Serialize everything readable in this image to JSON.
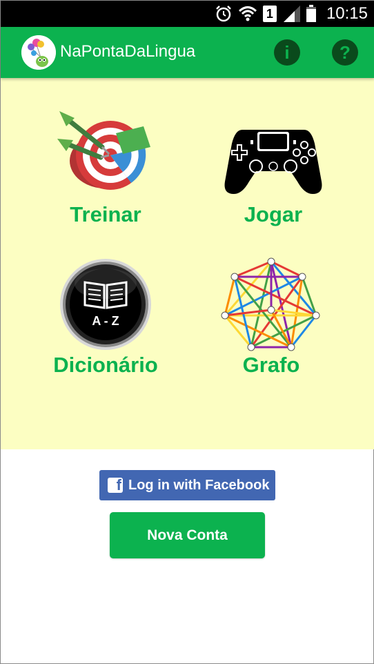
{
  "status_bar": {
    "time": "10:15",
    "sim_slot": "1",
    "icons": [
      "alarm-icon",
      "wifi-icon",
      "sim-icon",
      "signal-icon",
      "battery-icon"
    ]
  },
  "app_bar": {
    "title": "NaPontaDaLingua",
    "info_symbol": "i",
    "help_symbol": "?",
    "color": "#0cb24f"
  },
  "menu": {
    "background": "#fcfec2",
    "items": [
      {
        "label": "Treinar",
        "icon": "target-icon"
      },
      {
        "label": "Jogar",
        "icon": "gamepad-icon"
      },
      {
        "label": "Dicionário",
        "icon": "dictionary-icon"
      },
      {
        "label": "Grafo",
        "icon": "graph-icon"
      }
    ]
  },
  "dictionary_badge": "A - Z",
  "facebook": {
    "label": "Log in with Facebook",
    "icon_letter": "f",
    "color": "#4267b2"
  },
  "new_account": {
    "label": "Nova Conta"
  }
}
